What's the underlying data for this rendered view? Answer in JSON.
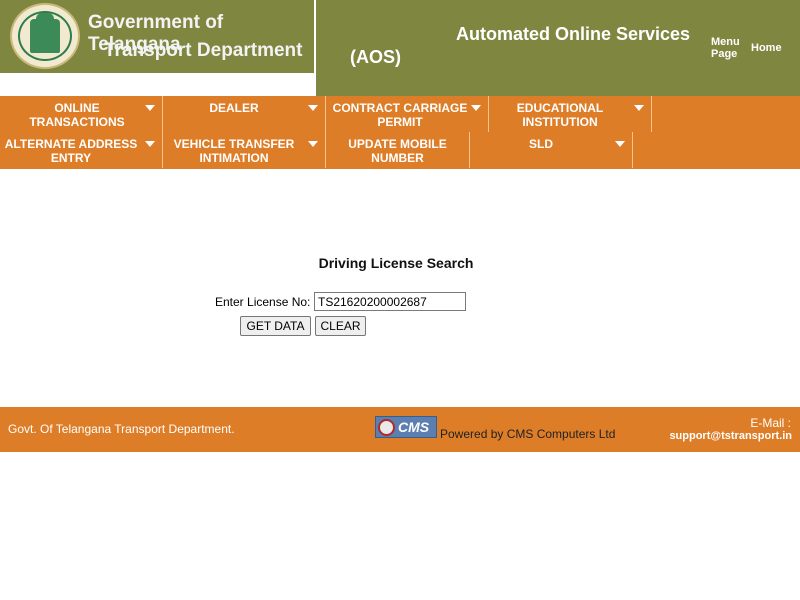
{
  "header": {
    "org_line_1": "Government of Telangana",
    "org_line_2": "Transport Department",
    "app_title": "Automated Online Services",
    "app_abbr": "(AOS)",
    "menu_page_label": "Menu Page",
    "home_label": "Home"
  },
  "nav": {
    "row1": [
      {
        "label": "ONLINE TRANSACTIONS"
      },
      {
        "label": "DEALER"
      },
      {
        "label": "CONTRACT CARRIAGE PERMIT"
      },
      {
        "label": "EDUCATIONAL INSTITUTION"
      }
    ],
    "row2": [
      {
        "label": "ALTERNATE ADDRESS ENTRY"
      },
      {
        "label": "VEHICLE TRANSFER INTIMATION"
      },
      {
        "label": "UPDATE MOBILE NUMBER"
      },
      {
        "label": "SLD"
      }
    ]
  },
  "main": {
    "title": "Driving License Search",
    "license_label": "Enter License No:",
    "license_value": "TS21620200002687",
    "get_data_label": "GET DATA",
    "clear_label": "CLEAR"
  },
  "footer": {
    "left_text": "Govt. Of Telangana Transport Department.",
    "logo_text": "CMS",
    "powered_by": "Powered by CMS Computers Ltd",
    "email_label": "E-Mail :",
    "email_value": "support@tstransport.in"
  },
  "colors": {
    "header_bg": "#7f8640",
    "nav_bg": "#de7d27",
    "footer_bg": "#de7d27"
  }
}
